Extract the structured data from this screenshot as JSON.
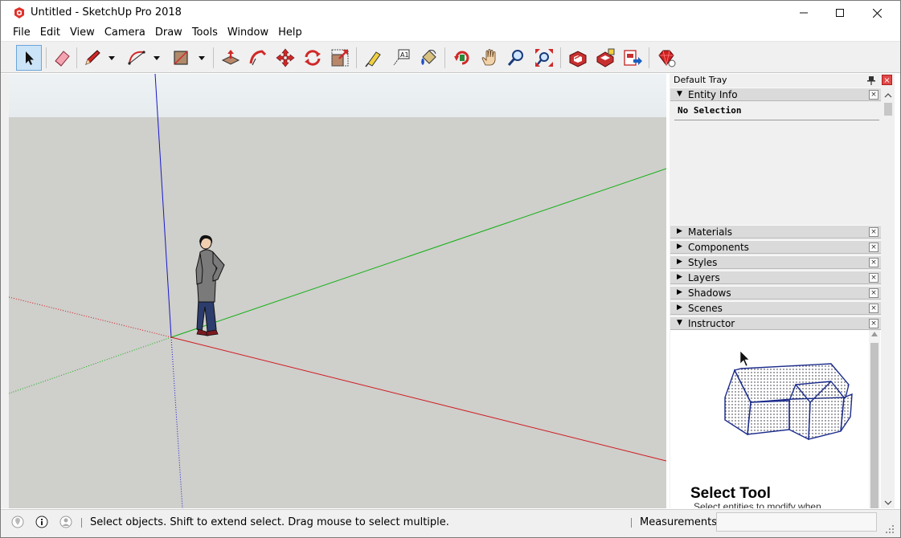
{
  "window": {
    "title": "Untitled - SketchUp Pro 2018",
    "controls": {
      "minimize": "—",
      "maximize": "☐",
      "close": "✕"
    }
  },
  "menu": [
    "File",
    "Edit",
    "View",
    "Camera",
    "Draw",
    "Tools",
    "Window",
    "Help"
  ],
  "toolbar": {
    "tools": [
      "select-tool",
      "eraser-tool",
      "line-tool",
      "arc-tool",
      "rectangle-tool",
      "push-pull-tool",
      "follow-me-tool",
      "move-tool",
      "rotate-tool",
      "scale-tool",
      "tape-measure-tool",
      "text-tool",
      "paint-bucket-tool",
      "orbit-tool",
      "pan-tool",
      "zoom-tool",
      "zoom-extents-tool",
      "3d-warehouse-tool",
      "extension-warehouse-tool",
      "send-to-layout-tool",
      "extension-manager-tool"
    ],
    "active_tool": "select-tool",
    "text_tool_glyph": "A1"
  },
  "tray": {
    "title": "Default Tray",
    "close_glyph": "×",
    "pin_glyph": "⊥",
    "panels": [
      {
        "label": "Entity Info",
        "expanded": true
      },
      {
        "label": "Materials",
        "expanded": false
      },
      {
        "label": "Components",
        "expanded": false
      },
      {
        "label": "Styles",
        "expanded": false
      },
      {
        "label": "Layers",
        "expanded": false
      },
      {
        "label": "Shadows",
        "expanded": false
      },
      {
        "label": "Scenes",
        "expanded": false
      },
      {
        "label": "Instructor",
        "expanded": true
      }
    ],
    "panel_close_glyph": "×",
    "arrow_expanded": "▼",
    "arrow_collapsed": "▶",
    "entity_info": {
      "selection": "No Selection"
    },
    "instructor": {
      "title": "Select Tool",
      "description": "Select entities to modify when"
    }
  },
  "status": {
    "message": "Select objects. Shift to extend select. Drag mouse to select multiple.",
    "measurements_label": "Measurements",
    "measurements_value": ""
  },
  "colors": {
    "axis_red": "#d01818",
    "axis_green": "#10b010",
    "axis_blue": "#1818c8",
    "ground": "#cfcfcc",
    "sky": "#e8eef0",
    "accent_tool": "#cce4f7"
  }
}
